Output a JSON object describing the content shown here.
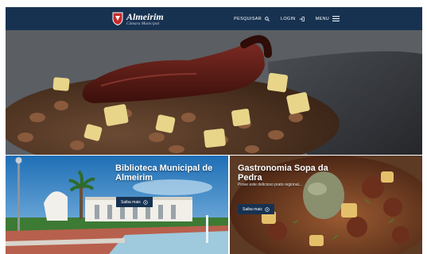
{
  "header": {
    "brand_name": "Almeirim",
    "brand_subtitle": "Câmara Municipal",
    "search_label": "PESQUISAR",
    "login_label": "LOGIN",
    "menu_label": "MENU"
  },
  "colors": {
    "navbar": "#173251",
    "button": "#173251",
    "crest_red": "#c62a2a"
  },
  "icons": {
    "search": "search-icon",
    "login": "login-icon",
    "menu": "hamburger-icon"
  },
  "cards": [
    {
      "title_line1": "Biblioteca Municipal de",
      "title_line2": "Almeirim",
      "button_label": "Saiba mais"
    },
    {
      "title_line1": "Gastronomia Sopa da",
      "title_line2": "Pedra",
      "description": "Prove este delicioso prato regional...",
      "button_label": "Saiba mais"
    }
  ]
}
